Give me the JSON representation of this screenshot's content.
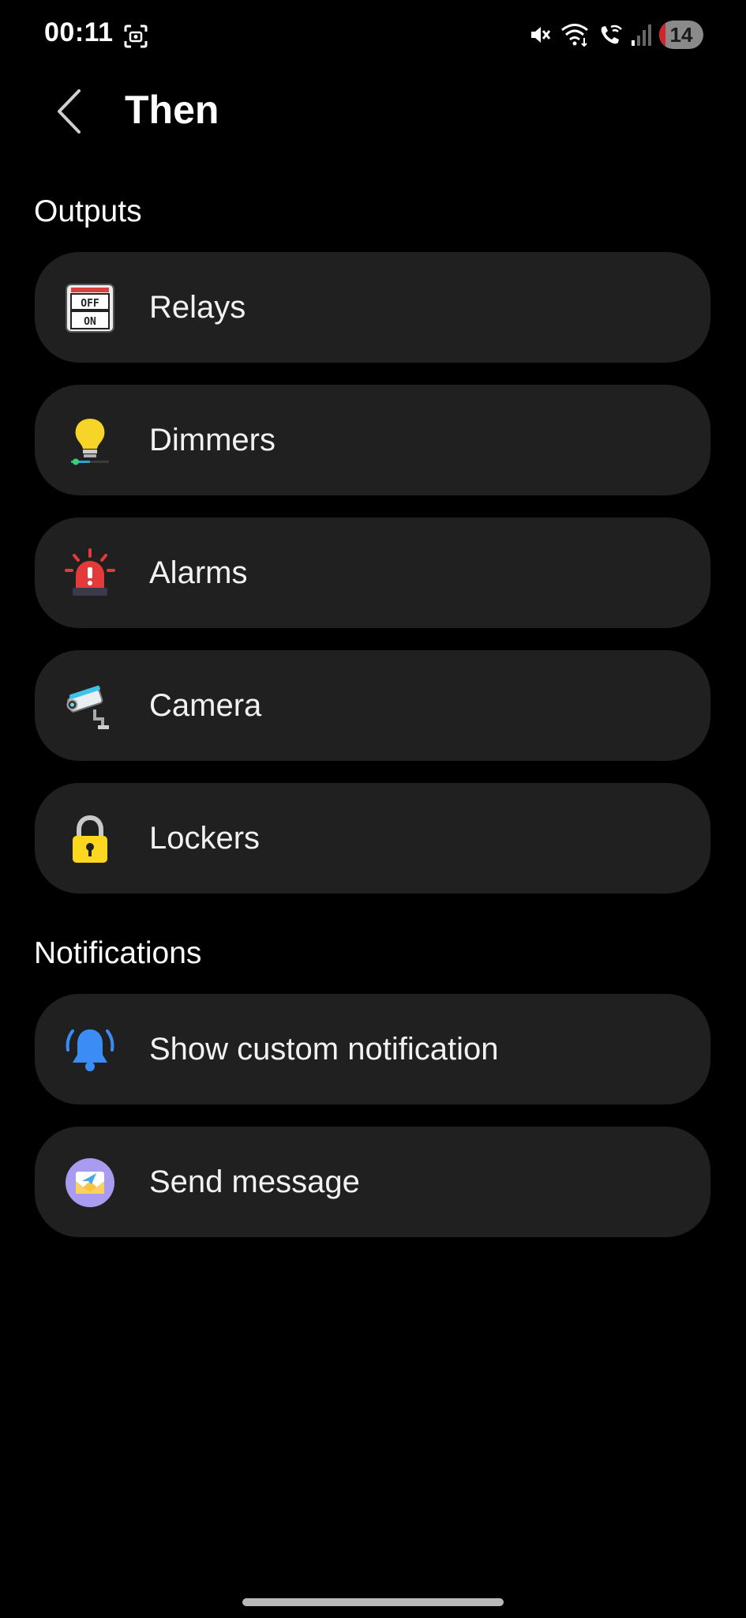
{
  "status_bar": {
    "time": "00:11",
    "battery_level": "14",
    "icons": [
      "screen-capture-icon",
      "mute-icon",
      "wifi-icon",
      "wifi-call-icon",
      "signal-icon"
    ]
  },
  "header": {
    "title": "Then",
    "back_icon": "chevron-left-icon"
  },
  "sections": {
    "outputs": {
      "title": "Outputs",
      "items": [
        {
          "label": "Relays",
          "icon": "relay-switch-icon"
        },
        {
          "label": "Dimmers",
          "icon": "dimmer-bulb-icon"
        },
        {
          "label": "Alarms",
          "icon": "alarm-siren-icon"
        },
        {
          "label": "Camera",
          "icon": "camera-icon"
        },
        {
          "label": "Lockers",
          "icon": "lock-icon"
        }
      ]
    },
    "notifications": {
      "title": "Notifications",
      "items": [
        {
          "label": "Show custom notification",
          "icon": "bell-icon"
        },
        {
          "label": "Send message",
          "icon": "message-icon"
        }
      ]
    }
  },
  "colors": {
    "background": "#000000",
    "card": "#202020",
    "text": "#ffffff",
    "battery_low": "#d2252b"
  }
}
